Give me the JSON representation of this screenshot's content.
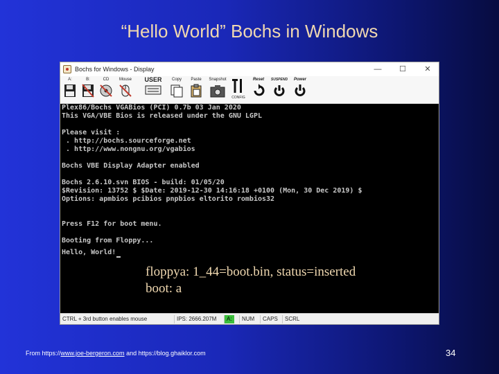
{
  "slide": {
    "title": "“Hello World” Bochs in Windows",
    "page_number": "34",
    "footer": {
      "prefix": "From https://",
      "link": "www.joe-bergeron.com",
      "suffix": " and https://blog.ghaiklor.com"
    }
  },
  "window": {
    "title": "Bochs for Windows - Display",
    "controls": {
      "minimize": "—",
      "maximize": "☐",
      "close": "✕"
    }
  },
  "toolbar": {
    "buttons": [
      {
        "label": "A:",
        "icon": "floppy-a-icon"
      },
      {
        "label": "B:",
        "icon": "floppy-b-icon"
      },
      {
        "label": "CD",
        "icon": "cdrom-icon"
      },
      {
        "label": "Mouse",
        "icon": "mouse-icon"
      },
      {
        "label": "USER",
        "icon": "user-icon"
      },
      {
        "label": "Copy",
        "icon": "copy-icon"
      },
      {
        "label": "Paste",
        "icon": "paste-icon"
      },
      {
        "label": "Snapshot",
        "icon": "snapshot-icon"
      },
      {
        "label": "CONFIG",
        "icon": "config-icon"
      },
      {
        "label": "Reset",
        "icon": "reset-icon"
      },
      {
        "label": "SUSPEND",
        "icon": "suspend-icon"
      },
      {
        "label": "Power",
        "icon": "power-icon"
      }
    ]
  },
  "screen": {
    "lines": [
      "Plex86/Bochs VGABios (PCI) 0.7b 03 Jan 2020",
      "This VGA/VBE Bios is released under the GNU LGPL",
      "",
      "Please visit :",
      " . http://bochs.sourceforge.net",
      " . http://www.nongnu.org/vgabios",
      "",
      "Bochs VBE Display Adapter enabled",
      "",
      "Bochs 2.6.10.svn BIOS - build: 01/05/20",
      "$Revision: 13752 $ $Date: 2019-12-30 14:16:18 +0100 (Mon, 30 Dec 2019) $",
      "Options: apmbios pcibios pnpbios eltorito rombios32",
      "",
      "",
      "Press F12 for boot menu.",
      "",
      "Booting from Floppy...",
      "Hello, World!"
    ]
  },
  "overlay": {
    "line1": "floppya: 1_44=boot.bin, status=inserted",
    "line2": "boot: a"
  },
  "statusbar": {
    "hint": "CTRL + 3rd button enables mouse",
    "ips": "IPS: 2666.207M",
    "drive": "A:",
    "num": "NUM",
    "caps": "CAPS",
    "scrl": "SCRL"
  }
}
